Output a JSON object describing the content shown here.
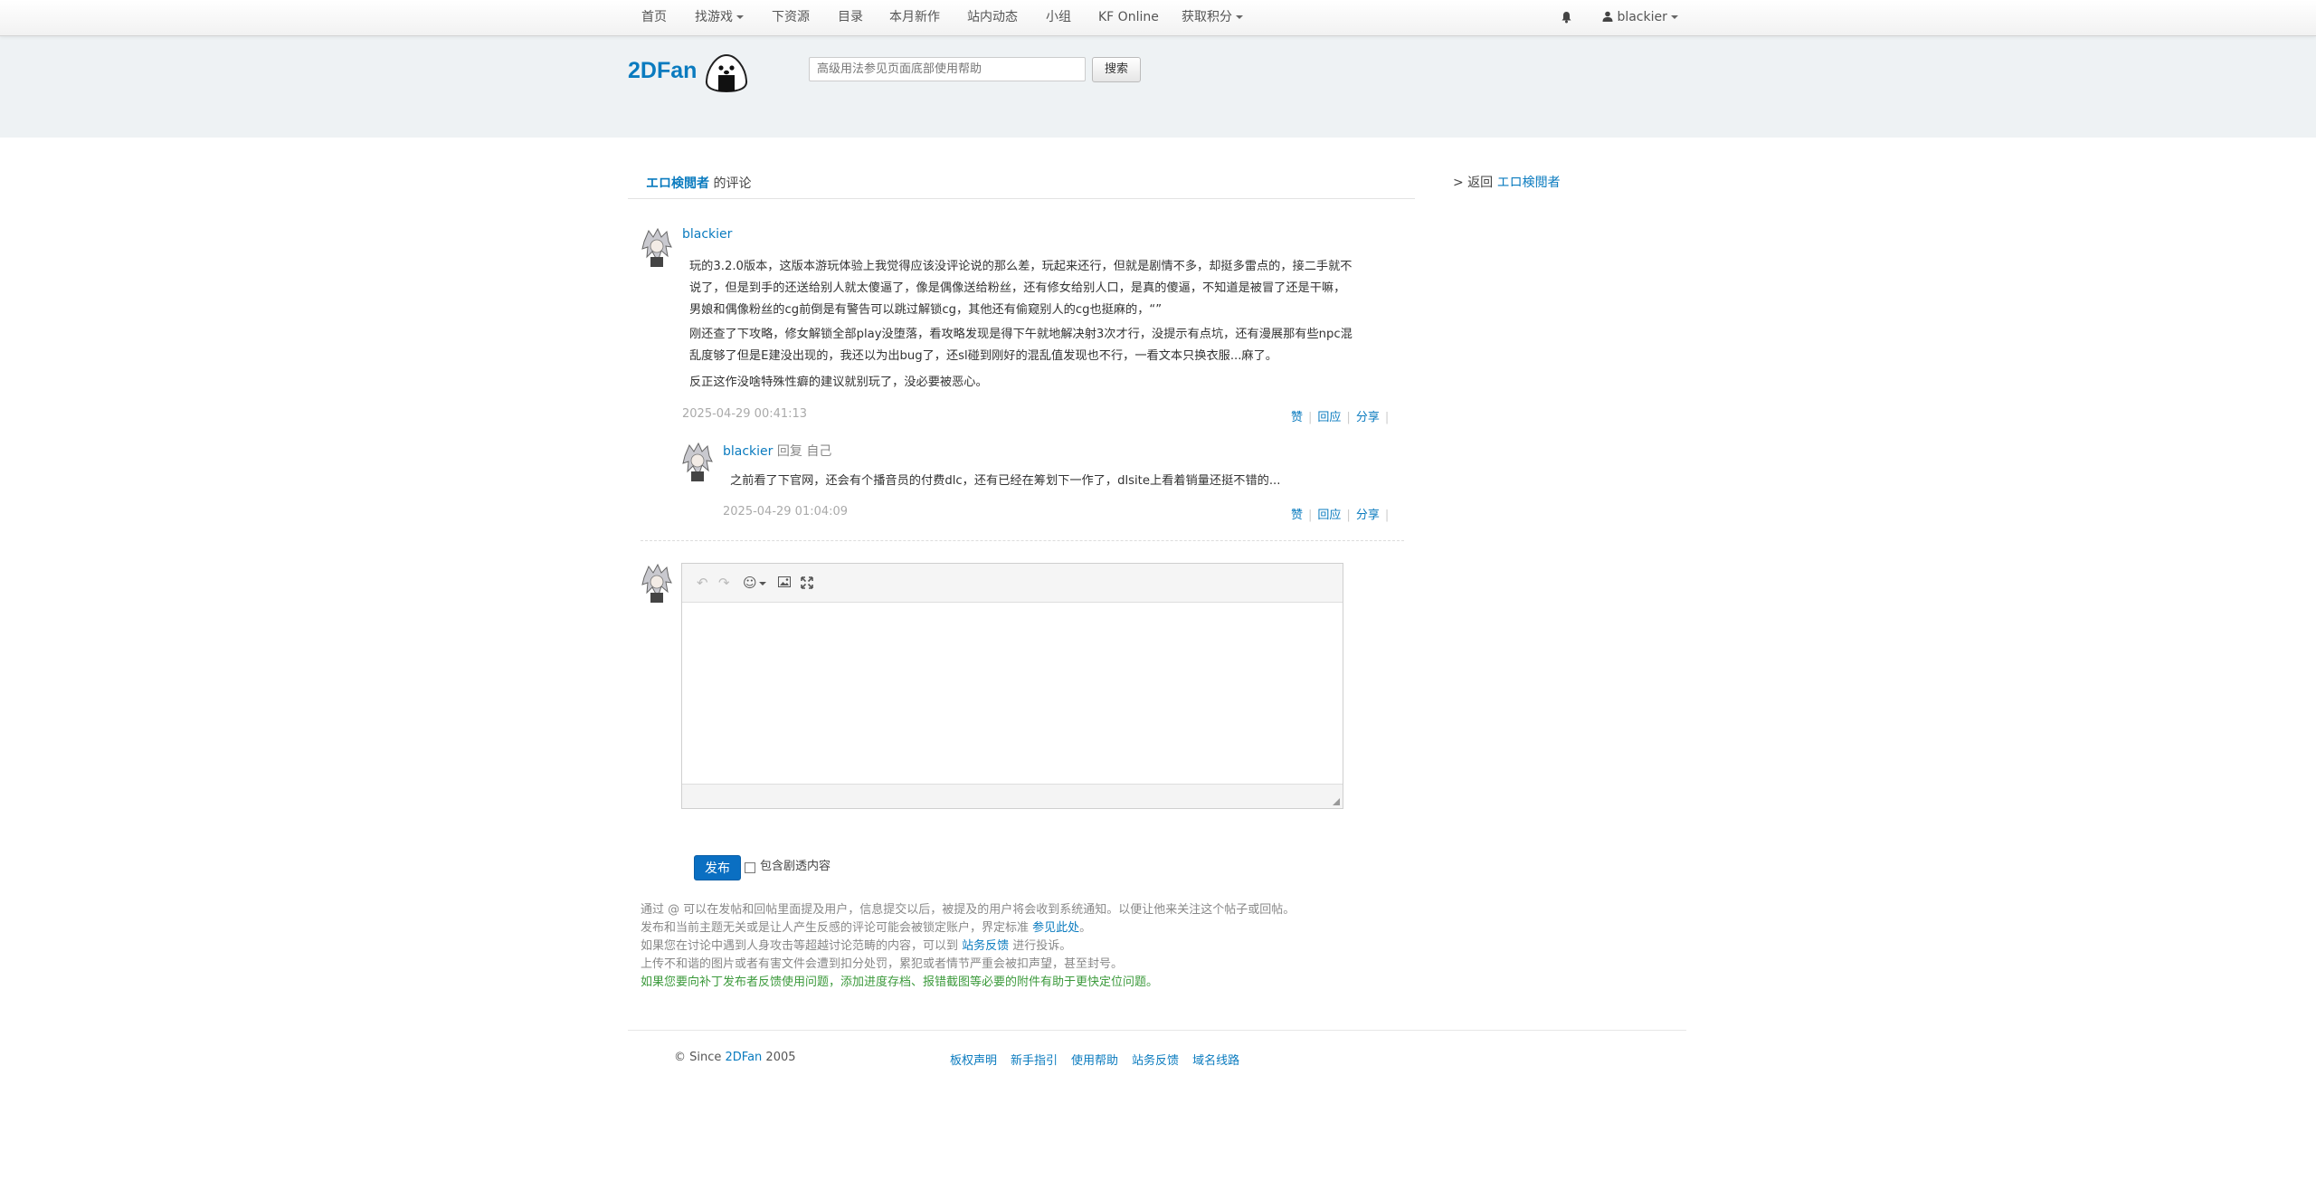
{
  "nav": {
    "items": [
      "首页",
      "找游戏",
      "下资源",
      "目录",
      "本月新作",
      "站内动态",
      "小组",
      "KF Online",
      "获取积分"
    ],
    "user": "blackier"
  },
  "header": {
    "logo": "2DFan",
    "search_placeholder": "高级用法参见页面底部使用帮助",
    "search_button": "搜索"
  },
  "breadcrumb": {
    "game": "エロ検閲者",
    "suffix": " 的评论"
  },
  "sidebar": {
    "back_prefix": "> 返回 ",
    "back_game": "エロ検閲者"
  },
  "comment": {
    "user": "blackier",
    "lines": [
      "玩的3.2.0版本，这版本游玩体验上我觉得应该没评论说的那么差，玩起来还行，但就是剧情不多，却挺多雷点的，接二手就不",
      "说了，但是到手的还送给别人就太傻逼了，像是偶像送给粉丝，还有修女给别人口，是真的傻逼，不知道是被冒了还是干嘛，",
      "男娘和偶像粉丝的cg前倒是有警告可以跳过解锁cg，其他还有偷窥别人的cg也挺麻的，“”",
      "刚还查了下攻略，修女解锁全部play没堕落，看攻略发现是得下午就地解决射3次才行，没提示有点坑，还有漫展那有些npc混",
      "乱度够了但是E建没出现的，我还以为出bug了，还sl碰到刚好的混乱值发现也不行，一看文本只换衣服...麻了。",
      "反正这作没啥特殊性癖的建议就别玩了，没必要被恶心。"
    ],
    "timestamp": "2025-04-29 00:41:13",
    "actions": [
      "赞",
      "回应",
      "分享"
    ]
  },
  "reply": {
    "user": "blackier",
    "hint": " 回复 自己",
    "text": "之前看了下官网，还会有个播音员的付费dlc，还有已经在筹划下一作了，dlsite上看着销量还挺不错的...",
    "timestamp": "2025-04-29 01:04:09",
    "actions": [
      "赞",
      "回应",
      "分享"
    ]
  },
  "editor": {
    "publish": "发布",
    "spoiler_label": "包含剧透内容"
  },
  "notes": {
    "line1": "通过 @ 可以在发帖和回帖里面提及用户，信息提交以后，被提及的用户将会收到系统通知。以便让他来关注这个帖子或回帖。",
    "line2_prefix": "发布和当前主题无关或是让人产生反感的评论可能会被锁定账户，界定标准 ",
    "line2_link": "参见此处",
    "line2_suffix": "。",
    "line3_prefix": "如果您在讨论中遇到人身攻击等超越讨论范畴的内容，可以到 ",
    "line3_link": "站务反馈",
    "line3_suffix": " 进行投诉。",
    "line4": "上传不和谐的图片或者有害文件会遭到扣分处罚，累犯或者情节严重会被扣声望，甚至封号。",
    "line5": "如果您要向补丁发布者反馈使用问题，添加进度存档、报错截图等必要的附件有助于更快定位问题。"
  },
  "footer": {
    "copy_prefix": "© Since ",
    "copy_brand": "2DFan",
    "copy_year": " 2005",
    "links": [
      "板权声明",
      "新手指引",
      "使用帮助",
      "站务反馈",
      "域名线路"
    ]
  }
}
